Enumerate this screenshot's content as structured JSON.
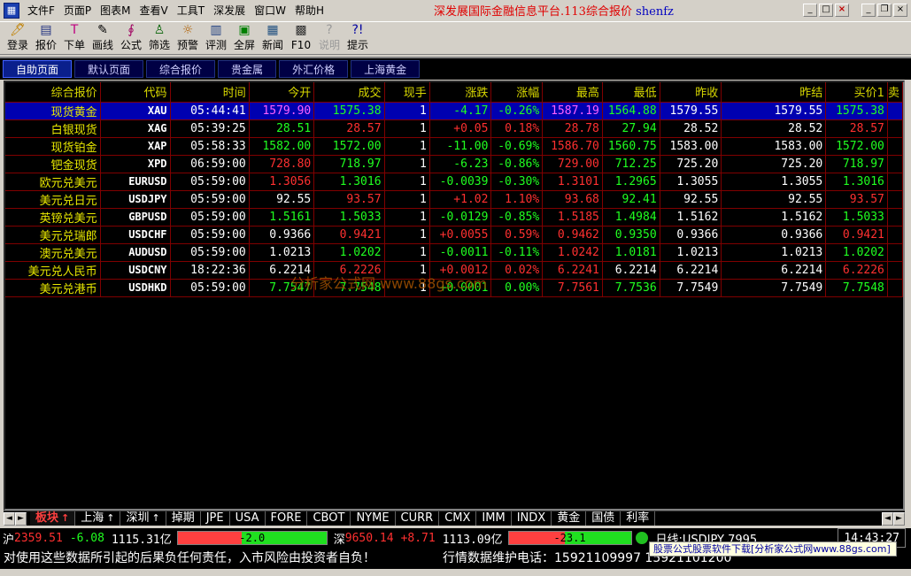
{
  "titlebar": {
    "app_icon": "chart-icon",
    "menus": [
      "文件F",
      "页面P",
      "图表M",
      "查看V",
      "工具T",
      "深发展",
      "窗口W",
      "帮助H"
    ],
    "title": "深发展国际金融信息平台.113综合报价",
    "user": "shenfz"
  },
  "toolbar": {
    "items": [
      {
        "label": "登录",
        "icon": "login-icon",
        "enabled": true
      },
      {
        "label": "报价",
        "icon": "quote-icon",
        "enabled": true
      },
      {
        "label": "下单",
        "icon": "order-icon",
        "enabled": true
      },
      {
        "label": "画线",
        "icon": "pen-icon",
        "enabled": true
      },
      {
        "label": "公式",
        "icon": "formula-icon",
        "enabled": true
      },
      {
        "label": "筛选",
        "icon": "filter-icon",
        "enabled": true
      },
      {
        "label": "预警",
        "icon": "alarm-icon",
        "enabled": true
      },
      {
        "label": "评测",
        "icon": "evaluate-icon",
        "enabled": true
      },
      {
        "label": "全屏",
        "icon": "fullscreen-icon",
        "enabled": true
      },
      {
        "label": "新闻",
        "icon": "news-icon",
        "enabled": true
      },
      {
        "label": "F10",
        "icon": "f10-icon",
        "enabled": true
      },
      {
        "label": "说明",
        "icon": "help-doc-icon",
        "enabled": false
      },
      {
        "label": "提示",
        "icon": "hint-icon",
        "enabled": true
      }
    ]
  },
  "nav_tabs": [
    "自助页面",
    "默认页面",
    "综合报价",
    "贵金属",
    "外汇价格",
    "上海黄金"
  ],
  "nav_active": 0,
  "table": {
    "columns": [
      "综合报价",
      "代码",
      "时间",
      "今开",
      "成交",
      "现手",
      "涨跌",
      "涨幅",
      "最高",
      "最低",
      "昨收",
      "昨结",
      "买价1",
      "卖"
    ],
    "rows": [
      {
        "name": "现货黄金",
        "code": "XAU",
        "time": "05:44:41",
        "open": "1579.90",
        "last": "1575.38",
        "vol": "1",
        "chg": "-4.17",
        "pct": "-0.26%",
        "high": "1587.19",
        "low": "1564.88",
        "prev": "1579.55",
        "settle": "1579.55",
        "bid": "1575.38",
        "colors": [
          "mg",
          "dn",
          "w",
          "dn",
          "dn",
          "mg",
          "dn",
          "w",
          "w",
          "dn"
        ]
      },
      {
        "name": "白银现货",
        "code": "XAG",
        "time": "05:39:25",
        "open": "28.51",
        "last": "28.57",
        "vol": "1",
        "chg": "+0.05",
        "pct": "0.18%",
        "high": "28.78",
        "low": "27.94",
        "prev": "28.52",
        "settle": "28.52",
        "bid": "28.57",
        "colors": [
          "dn",
          "up",
          "w",
          "up",
          "up",
          "up",
          "dn",
          "w",
          "w",
          "up"
        ]
      },
      {
        "name": "现货铂金",
        "code": "XAP",
        "time": "05:58:33",
        "open": "1582.00",
        "last": "1572.00",
        "vol": "1",
        "chg": "-11.00",
        "pct": "-0.69%",
        "high": "1586.70",
        "low": "1560.75",
        "prev": "1583.00",
        "settle": "1583.00",
        "bid": "1572.00",
        "colors": [
          "dn",
          "dn",
          "w",
          "dn",
          "dn",
          "up",
          "dn",
          "w",
          "w",
          "dn"
        ]
      },
      {
        "name": "钯金现货",
        "code": "XPD",
        "time": "06:59:00",
        "open": "728.80",
        "last": "718.97",
        "vol": "1",
        "chg": "-6.23",
        "pct": "-0.86%",
        "high": "729.00",
        "low": "712.25",
        "prev": "725.20",
        "settle": "725.20",
        "bid": "718.97",
        "colors": [
          "up",
          "dn",
          "w",
          "dn",
          "dn",
          "up",
          "dn",
          "w",
          "w",
          "dn"
        ]
      },
      {
        "name": "欧元兑美元",
        "code": "EURUSD",
        "time": "05:59:00",
        "open": "1.3056",
        "last": "1.3016",
        "vol": "1",
        "chg": "-0.0039",
        "pct": "-0.30%",
        "high": "1.3101",
        "low": "1.2965",
        "prev": "1.3055",
        "settle": "1.3055",
        "bid": "1.3016",
        "colors": [
          "up",
          "dn",
          "w",
          "dn",
          "dn",
          "up",
          "dn",
          "w",
          "w",
          "dn"
        ]
      },
      {
        "name": "美元兑日元",
        "code": "USDJPY",
        "time": "05:59:00",
        "open": "92.55",
        "last": "93.57",
        "vol": "1",
        "chg": "+1.02",
        "pct": "1.10%",
        "high": "93.68",
        "low": "92.41",
        "prev": "92.55",
        "settle": "92.55",
        "bid": "93.57",
        "colors": [
          "w",
          "up",
          "w",
          "up",
          "up",
          "up",
          "dn",
          "w",
          "w",
          "up"
        ]
      },
      {
        "name": "英镑兑美元",
        "code": "GBPUSD",
        "time": "05:59:00",
        "open": "1.5161",
        "last": "1.5033",
        "vol": "1",
        "chg": "-0.0129",
        "pct": "-0.85%",
        "high": "1.5185",
        "low": "1.4984",
        "prev": "1.5162",
        "settle": "1.5162",
        "bid": "1.5033",
        "colors": [
          "dn",
          "dn",
          "w",
          "dn",
          "dn",
          "up",
          "dn",
          "w",
          "w",
          "dn"
        ]
      },
      {
        "name": "美元兑瑞郎",
        "code": "USDCHF",
        "time": "05:59:00",
        "open": "0.9366",
        "last": "0.9421",
        "vol": "1",
        "chg": "+0.0055",
        "pct": "0.59%",
        "high": "0.9462",
        "low": "0.9350",
        "prev": "0.9366",
        "settle": "0.9366",
        "bid": "0.9421",
        "colors": [
          "w",
          "up",
          "w",
          "up",
          "up",
          "up",
          "dn",
          "w",
          "w",
          "up"
        ]
      },
      {
        "name": "澳元兑美元",
        "code": "AUDUSD",
        "time": "05:59:00",
        "open": "1.0213",
        "last": "1.0202",
        "vol": "1",
        "chg": "-0.0011",
        "pct": "-0.11%",
        "high": "1.0242",
        "low": "1.0181",
        "prev": "1.0213",
        "settle": "1.0213",
        "bid": "1.0202",
        "colors": [
          "w",
          "dn",
          "w",
          "dn",
          "dn",
          "up",
          "dn",
          "w",
          "w",
          "dn"
        ]
      },
      {
        "name": "美元兑人民币",
        "code": "USDCNY",
        "time": "18:22:36",
        "open": "6.2214",
        "last": "6.2226",
        "vol": "1",
        "chg": "+0.0012",
        "pct": "0.02%",
        "high": "6.2241",
        "low": "6.2214",
        "prev": "6.2214",
        "settle": "6.2214",
        "bid": "6.2226",
        "colors": [
          "w",
          "up",
          "w",
          "up",
          "up",
          "up",
          "w",
          "w",
          "w",
          "up"
        ]
      },
      {
        "name": "美元兑港币",
        "code": "USDHKD",
        "time": "05:59:00",
        "open": "7.7547",
        "last": "7.7548",
        "vol": "1",
        "chg": "+0.0001",
        "pct": "0.00%",
        "high": "7.7561",
        "low": "7.7536",
        "prev": "7.7549",
        "settle": "7.7549",
        "bid": "7.7548",
        "colors": [
          "dn",
          "dn",
          "w",
          "dn",
          "dn",
          "up",
          "dn",
          "w",
          "w",
          "dn"
        ]
      }
    ],
    "selected_row": 0
  },
  "watermark": "分析家公式网 www.88gs.com",
  "categories": {
    "items": [
      {
        "label": "板块",
        "arrow": "↑",
        "active": true
      },
      {
        "label": "上海",
        "arrow": "↑",
        "active": false
      },
      {
        "label": "深圳",
        "arrow": "↑",
        "active": false
      },
      {
        "label": "掉期",
        "arrow": "",
        "active": false
      },
      {
        "label": "JPE",
        "arrow": "",
        "active": false
      },
      {
        "label": "USA",
        "arrow": "",
        "active": false
      },
      {
        "label": "FORE",
        "arrow": "",
        "active": false
      },
      {
        "label": "CBOT",
        "arrow": "",
        "active": false
      },
      {
        "label": "NYME",
        "arrow": "",
        "active": false
      },
      {
        "label": "CURR",
        "arrow": "",
        "active": false
      },
      {
        "label": "CMX",
        "arrow": "",
        "active": false
      },
      {
        "label": "IMM",
        "arrow": "",
        "active": false
      },
      {
        "label": "INDX",
        "arrow": "",
        "active": false
      },
      {
        "label": "黄金",
        "arrow": "",
        "active": false
      },
      {
        "label": "国债",
        "arrow": "",
        "active": false
      },
      {
        "label": "利率",
        "arrow": "",
        "active": false
      }
    ]
  },
  "ticker": {
    "sh_label": "沪",
    "sh_index": "2359.51",
    "sh_chg": "-6.08",
    "sh_amount": "1115.31亿",
    "sh_bar_value": "-2.0",
    "sh_bar_red_fraction": 0.43,
    "sz_label": "深",
    "sz_index": "9650.14",
    "sz_chg": "+8.71",
    "sz_amount": "1113.09亿",
    "sz_bar_value": "-23.1",
    "sz_bar_red_fraction": 0.46,
    "line_label": "日线:USDJPY 7995",
    "clock": "14:43:27"
  },
  "footer": {
    "disclaimer": "对使用这些数据所引起的后果负任何责任，入市风险由投资者自负！",
    "hotline": "行情数据维护电话：15921109997 15921101200",
    "ad": "股票公式股票软件下载[分析家公式网www.88gs.com]"
  }
}
